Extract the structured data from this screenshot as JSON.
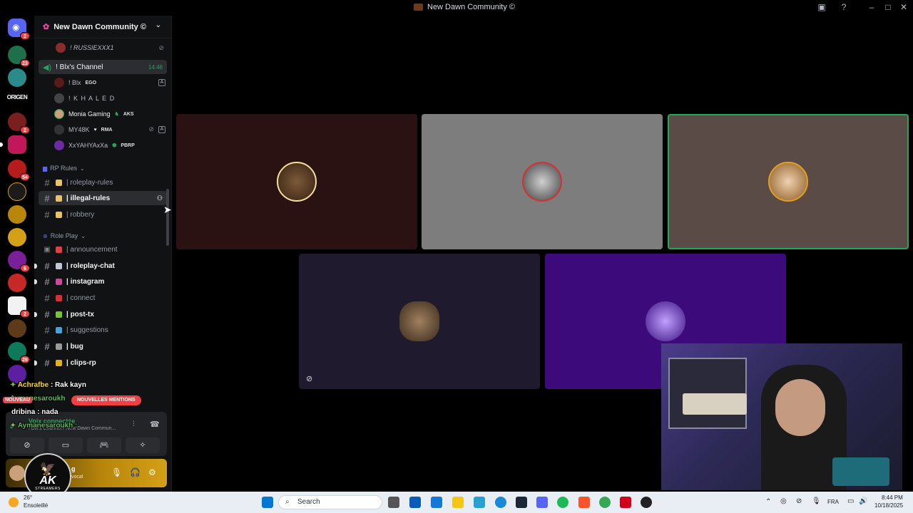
{
  "window": {
    "title": "New Dawn Community ©"
  },
  "rail": {
    "badges": [
      "2",
      "23",
      "2",
      "54",
      "6",
      "2",
      "26"
    ],
    "origen_label": "ORIGEN"
  },
  "server": {
    "name": "New Dawn Community ©"
  },
  "channels": {
    "top_user": "! RUSSIEXXX1",
    "voice_channel": {
      "name": "! Blx's Channel",
      "time": "14:46"
    },
    "voice_users": [
      {
        "name": "! Blx",
        "tag": "EGO"
      },
      {
        "name": "! K H A L E D",
        "tag": ""
      },
      {
        "name": "Monia Gaming",
        "tag": "AKS"
      },
      {
        "name": "MY48K",
        "tag": "RMA"
      },
      {
        "name": "XxYAHYAxXa",
        "tag": "PBRP"
      }
    ],
    "cat_rp_rules": "RP Rules",
    "rp_rules": [
      "| roleplay-rules",
      "| illegal-rules",
      "| robbery"
    ],
    "cat_role_play": "Role Play",
    "role_play": [
      "| announcement",
      "| roleplay-chat",
      "| instagram",
      "| connect",
      "| post-tx",
      "| suggestions",
      "| bug",
      "| clips-rp"
    ]
  },
  "overlay_chat": [
    {
      "user": "Achrafbe",
      "text": " : Rak kayn",
      "color": "#f7d44a"
    },
    {
      "user": "Aymanesaroukh",
      "text": "",
      "color": "#4ec04e"
    },
    {
      "user": "dribina",
      "text": " : nada",
      "color": "#ffffff"
    },
    {
      "user": "Aymanesaroukh",
      "text": " :",
      "color": "#4ec04e"
    }
  ],
  "notice": {
    "nouveau": "NOUVEAU",
    "mentions": "NOUVELLES MENTIONS"
  },
  "voice_panel": {
    "status": "Voix connectée",
    "location": "! Blx's Channel / New Dawn Commun..."
  },
  "user_panel": {
    "name": "g",
    "status": "vocal"
  },
  "stream_logo": {
    "brand": "AK",
    "sub": "STREAMERS"
  },
  "taskbar": {
    "weather_temp": "26°",
    "weather_desc": "Ensoleillé",
    "search_placeholder": "Search",
    "lang": "FRA",
    "time": "8:44 PM",
    "date": "10/18/2025"
  },
  "colors": {
    "accent_green": "#23a55a",
    "danger": "#f23f43",
    "tile1": "#2a1212",
    "tile2": "#7d7d7d",
    "tile3": "#5a4b46",
    "tile4": "#201a2e",
    "tile5": "#3c0a7a"
  }
}
